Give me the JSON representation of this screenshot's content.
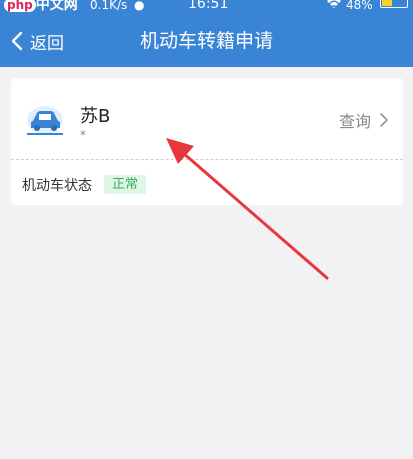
{
  "status_bar": {
    "logo_php": "php",
    "logo_cn": "中文网",
    "speed": "0.1K/s",
    "time": "16:51",
    "battery": "48%"
  },
  "nav": {
    "back_label": "返回",
    "title": "机动车转籍申请"
  },
  "vehicle": {
    "plate": "苏B",
    "sub": "*",
    "query_label": "查询",
    "status_label": "机动车状态",
    "status_value": "正常"
  },
  "colors": {
    "header_blue": "#3a84d6",
    "status_green": "#3cae5a",
    "annotation_red": "#e8363c"
  },
  "icons": [
    "back-chevron-icon",
    "car-icon",
    "chevron-right-icon",
    "wifi-icon",
    "battery-icon"
  ]
}
